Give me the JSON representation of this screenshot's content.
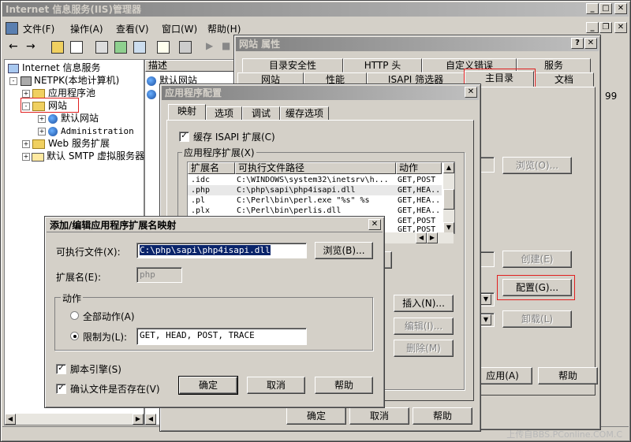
{
  "main": {
    "title": "Internet 信息服务(IIS)管理器",
    "menu": [
      "文件(F)",
      "操作(A)",
      "查看(V)",
      "窗口(W)",
      "帮助(H)"
    ],
    "tree": {
      "root": "Internet 信息服务",
      "computer": "NETPK(本地计算机)",
      "app_pools": "应用程序池",
      "websites": "网站",
      "default_site": "默认网站",
      "admin_site": "Administration",
      "web_ext": "Web 服务扩展",
      "smtp": "默认 SMTP 虚拟服务器"
    },
    "list_header": "描述",
    "list_item": "默认网站",
    "watermark": "上传自BBS.PConline.COM.C"
  },
  "site_props": {
    "title": "网站 属性",
    "tabs_row1": [
      "目录安全性",
      "HTTP 头",
      "自定义错误",
      "服务"
    ],
    "tabs_row2": [
      "网站",
      "性能",
      "ISAPI 筛选器",
      "主目录",
      "文档"
    ],
    "browse": "浏览(O)...",
    "create": "创建(E)",
    "config": "配置(G)...",
    "unload": "卸载(L)",
    "apply": "应用(A)",
    "help": "帮助",
    "partial_99": "99"
  },
  "app_config": {
    "title": "应用程序配置",
    "tabs": [
      "映射",
      "选项",
      "调试",
      "缓存选项"
    ],
    "cache_isapi": "缓存 ISAPI 扩展(C)",
    "group_label": "应用程序扩展(X)",
    "columns": [
      "扩展名",
      "可执行文件路径",
      "动作"
    ],
    "rows": [
      {
        "ext": ".idc",
        "path": "C:\\WINDOWS\\system32\\inetsrv\\h...",
        "verbs": "GET,POST"
      },
      {
        "ext": ".php",
        "path": "C:\\php\\sapi\\php4isapi.dll",
        "verbs": "GET,HEA..."
      },
      {
        "ext": ".pl",
        "path": "C:\\Perl\\bin\\perl.exe \"%s\" %s",
        "verbs": "GET,HEA..."
      },
      {
        "ext": ".plx",
        "path": "C:\\Perl\\bin\\perlis.dll",
        "verbs": "GET,HEA..."
      },
      {
        "ext": "",
        "path": "",
        "verbs": "GET,POST"
      },
      {
        "ext": "",
        "path": "",
        "verbs": "GET,POST"
      }
    ],
    "insert": "插入(N)...",
    "edit": "编辑(I)...",
    "delete": "删除(M)",
    "ok": "确定",
    "cancel": "取消",
    "help": "帮助"
  },
  "edit_dialog": {
    "title": "添加/编辑应用程序扩展名映射",
    "exe_label": "可执行文件(X):",
    "exe_value": "C:\\php\\sapi\\php4isapi.dll",
    "browse": "浏览(B)...",
    "ext_label": "扩展名(E):",
    "ext_value": "php",
    "verbs_group": "动作",
    "all_verbs": "全部动作(A)",
    "limit_to": "限制为(L):",
    "limit_value": "GET, HEAD, POST, TRACE",
    "script_engine": "脚本引擎(S)",
    "verify_file": "确认文件是否存在(V)",
    "ok": "确定",
    "cancel": "取消",
    "help": "帮助"
  }
}
